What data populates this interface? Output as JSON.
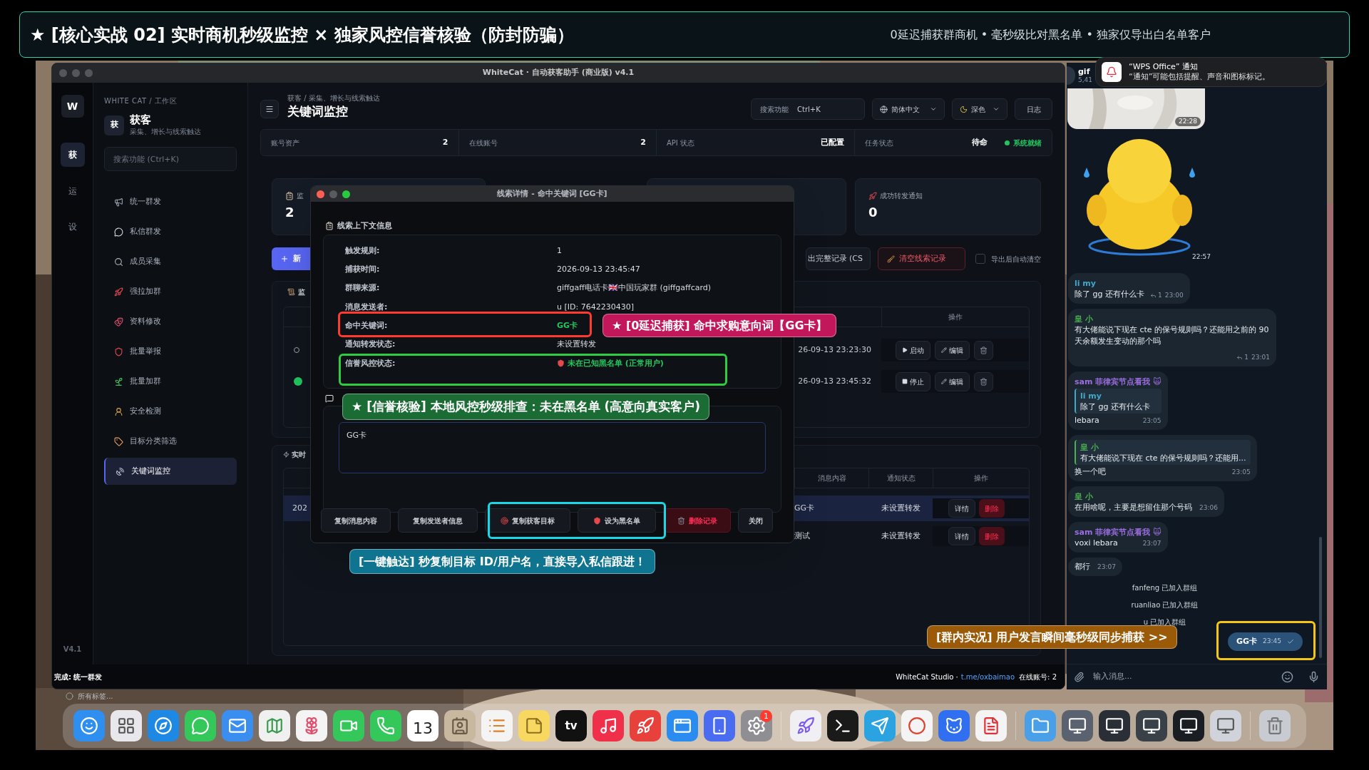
{
  "banner": {
    "title": "★ [核心实战 02] 实时商机秒级监控 × 独家风控信誉核验（防封防骗）",
    "subtitle": "0延迟捕获群商机 • 毫秒级比对黑名单 • 独家仅导出白名单客户"
  },
  "window": {
    "title": "WhiteCat · 自动获客助手 (商业版) v4.1"
  },
  "rail": {
    "logo": "W",
    "items": [
      {
        "label": "获",
        "selected": true
      },
      {
        "label": "运",
        "selected": false
      },
      {
        "label": "设",
        "selected": false
      }
    ],
    "version": "V4.1"
  },
  "sidebar": {
    "workspace": "WHITE CAT / 工作区",
    "section_badge": "获",
    "section_title": "获客",
    "section_subtitle": "采集、增长与线索触达",
    "search_placeholder": "搜索功能 (Ctrl+K)",
    "items": [
      {
        "label": "统一群发",
        "selected": false
      },
      {
        "label": "私信群发",
        "selected": false
      },
      {
        "label": "成员采集",
        "selected": false
      },
      {
        "label": "强拉加群",
        "selected": false
      },
      {
        "label": "资料修改",
        "selected": false
      },
      {
        "label": "批量举报",
        "selected": false
      },
      {
        "label": "批量加群",
        "selected": false
      },
      {
        "label": "安全检测",
        "selected": false
      },
      {
        "label": "目标分类筛选",
        "selected": false
      },
      {
        "label": "关键词监控",
        "selected": true
      }
    ]
  },
  "header": {
    "breadcrumb": "获客 / 采集、增长与线索触达",
    "title": "关键词监控",
    "search_label": "搜索功能",
    "search_shortcut": "Ctrl+K",
    "language": "简体中文",
    "theme": "深色",
    "log": "日志"
  },
  "stats": [
    {
      "label": "账号资产",
      "value": "2"
    },
    {
      "label": "在线账号",
      "value": "2"
    },
    {
      "label": "API 状态",
      "value": "已配置"
    },
    {
      "label": "任务状态",
      "value": "待命"
    }
  ],
  "system_status": "系统就绪",
  "cards": {
    "monitor_label": "监",
    "monitor_value": "2",
    "forward_label": "成功转发通知",
    "forward_value": "0"
  },
  "toolbar": {
    "new_button": "新",
    "export_button": "出完整记录 (CS",
    "clear_button": "清空线索记录",
    "auto_clear": {
      "label": "导出后自动清空",
      "checked": false
    }
  },
  "monitor": {
    "title": "监",
    "actions_header": "操作",
    "rows": [
      {
        "running": false,
        "time": "26-09-13 23:23:30",
        "toggle": "启动",
        "edit": "编辑"
      },
      {
        "running": true,
        "time": "26-09-13 23:45:32",
        "toggle": "停止",
        "edit": "编辑"
      }
    ]
  },
  "leads": {
    "title": "实时",
    "columns": [
      "消息内容",
      "通知状态",
      "操作"
    ],
    "rows": [
      {
        "selected": true,
        "column_1": "202",
        "content": "GG卡",
        "status": "未设置转发",
        "detail": "详情",
        "delete": "删除"
      },
      {
        "selected": false,
        "content": "测试",
        "status": "未设置转发",
        "detail": "详情",
        "delete": "删除"
      }
    ]
  },
  "dialog": {
    "title": "线索详情 - 命中关键词 [GG卡]",
    "section": "线索上下文信息",
    "fields": [
      {
        "label": "触发规则:",
        "value": "1",
        "kind": "plain"
      },
      {
        "label": "捕获时间:",
        "value": "2026-09-13 23:45:47",
        "kind": "plain"
      },
      {
        "label": "群聊来源:",
        "value": "giffgaff电话卡🇬🇧中国玩家群 (giffgaffcard)",
        "kind": "plain"
      },
      {
        "label": "消息发送者:",
        "value": "u [ID: 7642230430]",
        "kind": "plain"
      },
      {
        "label": "命中关键词:",
        "value": "GG卡",
        "kind": "keyword"
      },
      {
        "label": "通知转发状态:",
        "value": "未设置转发",
        "kind": "plain"
      },
      {
        "label": "信誉风控状态:",
        "value": "未在已知黑名单 (正常用户)",
        "kind": "status"
      }
    ],
    "message": "GG卡",
    "buttons": [
      {
        "label": "复制消息内容",
        "kind": "plain"
      },
      {
        "label": "复制发送者信息",
        "kind": "plain"
      },
      {
        "label": "复制获客目标",
        "kind": "target"
      },
      {
        "label": "设为黑名单",
        "kind": "shield"
      },
      {
        "label": "删除记录",
        "kind": "danger"
      },
      {
        "label": "关闭",
        "kind": "plain"
      }
    ]
  },
  "callouts": [
    {
      "text": "★ [0延迟捕获] 命中求购意向词【GG卡】",
      "color": "#c2185b"
    },
    {
      "text": "★ [信誉核验] 本地风控秒级排查：未在黑名单 (高意向真实客户)",
      "color": "#1b6b34"
    },
    {
      "text": "[一键触达] 秒复制目标 ID/用户名，直接导入私信跟进！",
      "color": "#0e7490"
    },
    {
      "text": "[群内实况] 用户发言瞬间毫秒级同步捕获 >>",
      "color": "#9a5a08"
    }
  ],
  "status_bar": {
    "left": "完成: 统一群发",
    "studio": "WhiteCat Studio ·",
    "link": "t.me/oxbaimao",
    "accounts": "在线账号: 2"
  },
  "notification": {
    "title": "“WPS Office” 通知",
    "body": "“通知”可能包括提醒、声音和图标标记。"
  },
  "chat": {
    "header_title": "gif",
    "header_subtitle": "5,41",
    "photo_time": "22:28",
    "sticker_time": "22:57",
    "messages": [
      {
        "sender": "li my",
        "color": "#3fa9c9",
        "text": "除了 gg 还有什么卡",
        "replies": "1",
        "time": "23:00"
      },
      {
        "sender": "皇 小",
        "color": "#4caf50",
        "text": "有大佬能说下现在 cte 的保号规则吗？还能用之前的 90 天余额发生变动的那个吗",
        "replies": "1",
        "time": "23:01"
      },
      {
        "sender": "sam 菲律宾节点看我 🙀",
        "color": "#9b6ee0",
        "quote": {
          "sender": "li my",
          "color": "#3fa9c9",
          "text": "除了 gg 还有什么卡"
        },
        "text": "lebara",
        "time": "23:05"
      },
      {
        "quote": {
          "sender": "皇 小",
          "color": "#4caf50",
          "text": "有大佬能说下现在 cte 的保号规则吗？还能用..."
        },
        "text": "换一个吧",
        "time": "23:05"
      },
      {
        "sender": "皇 小",
        "color": "#4caf50",
        "text": "在用啥呢，主要是想留住那个号码",
        "time": "23:06"
      },
      {
        "sender": "sam 菲律宾节点看我 🙀",
        "color": "#9b6ee0",
        "text": "voxi lebara",
        "time": "23:07"
      },
      {
        "text": "都行",
        "time": "23:07"
      }
    ],
    "service": [
      "fanfeng 已加入群组",
      "ruanliao 已加入群组",
      "u 已加入群组"
    ],
    "outgoing": {
      "text": "GG卡",
      "time": "23:45"
    },
    "input_placeholder": "输入消息..."
  },
  "desktop": {
    "tag_filter": "所有标签..."
  },
  "dock": {
    "calendar_day": "13",
    "settings_badge": "1",
    "tv_label": "tv"
  }
}
